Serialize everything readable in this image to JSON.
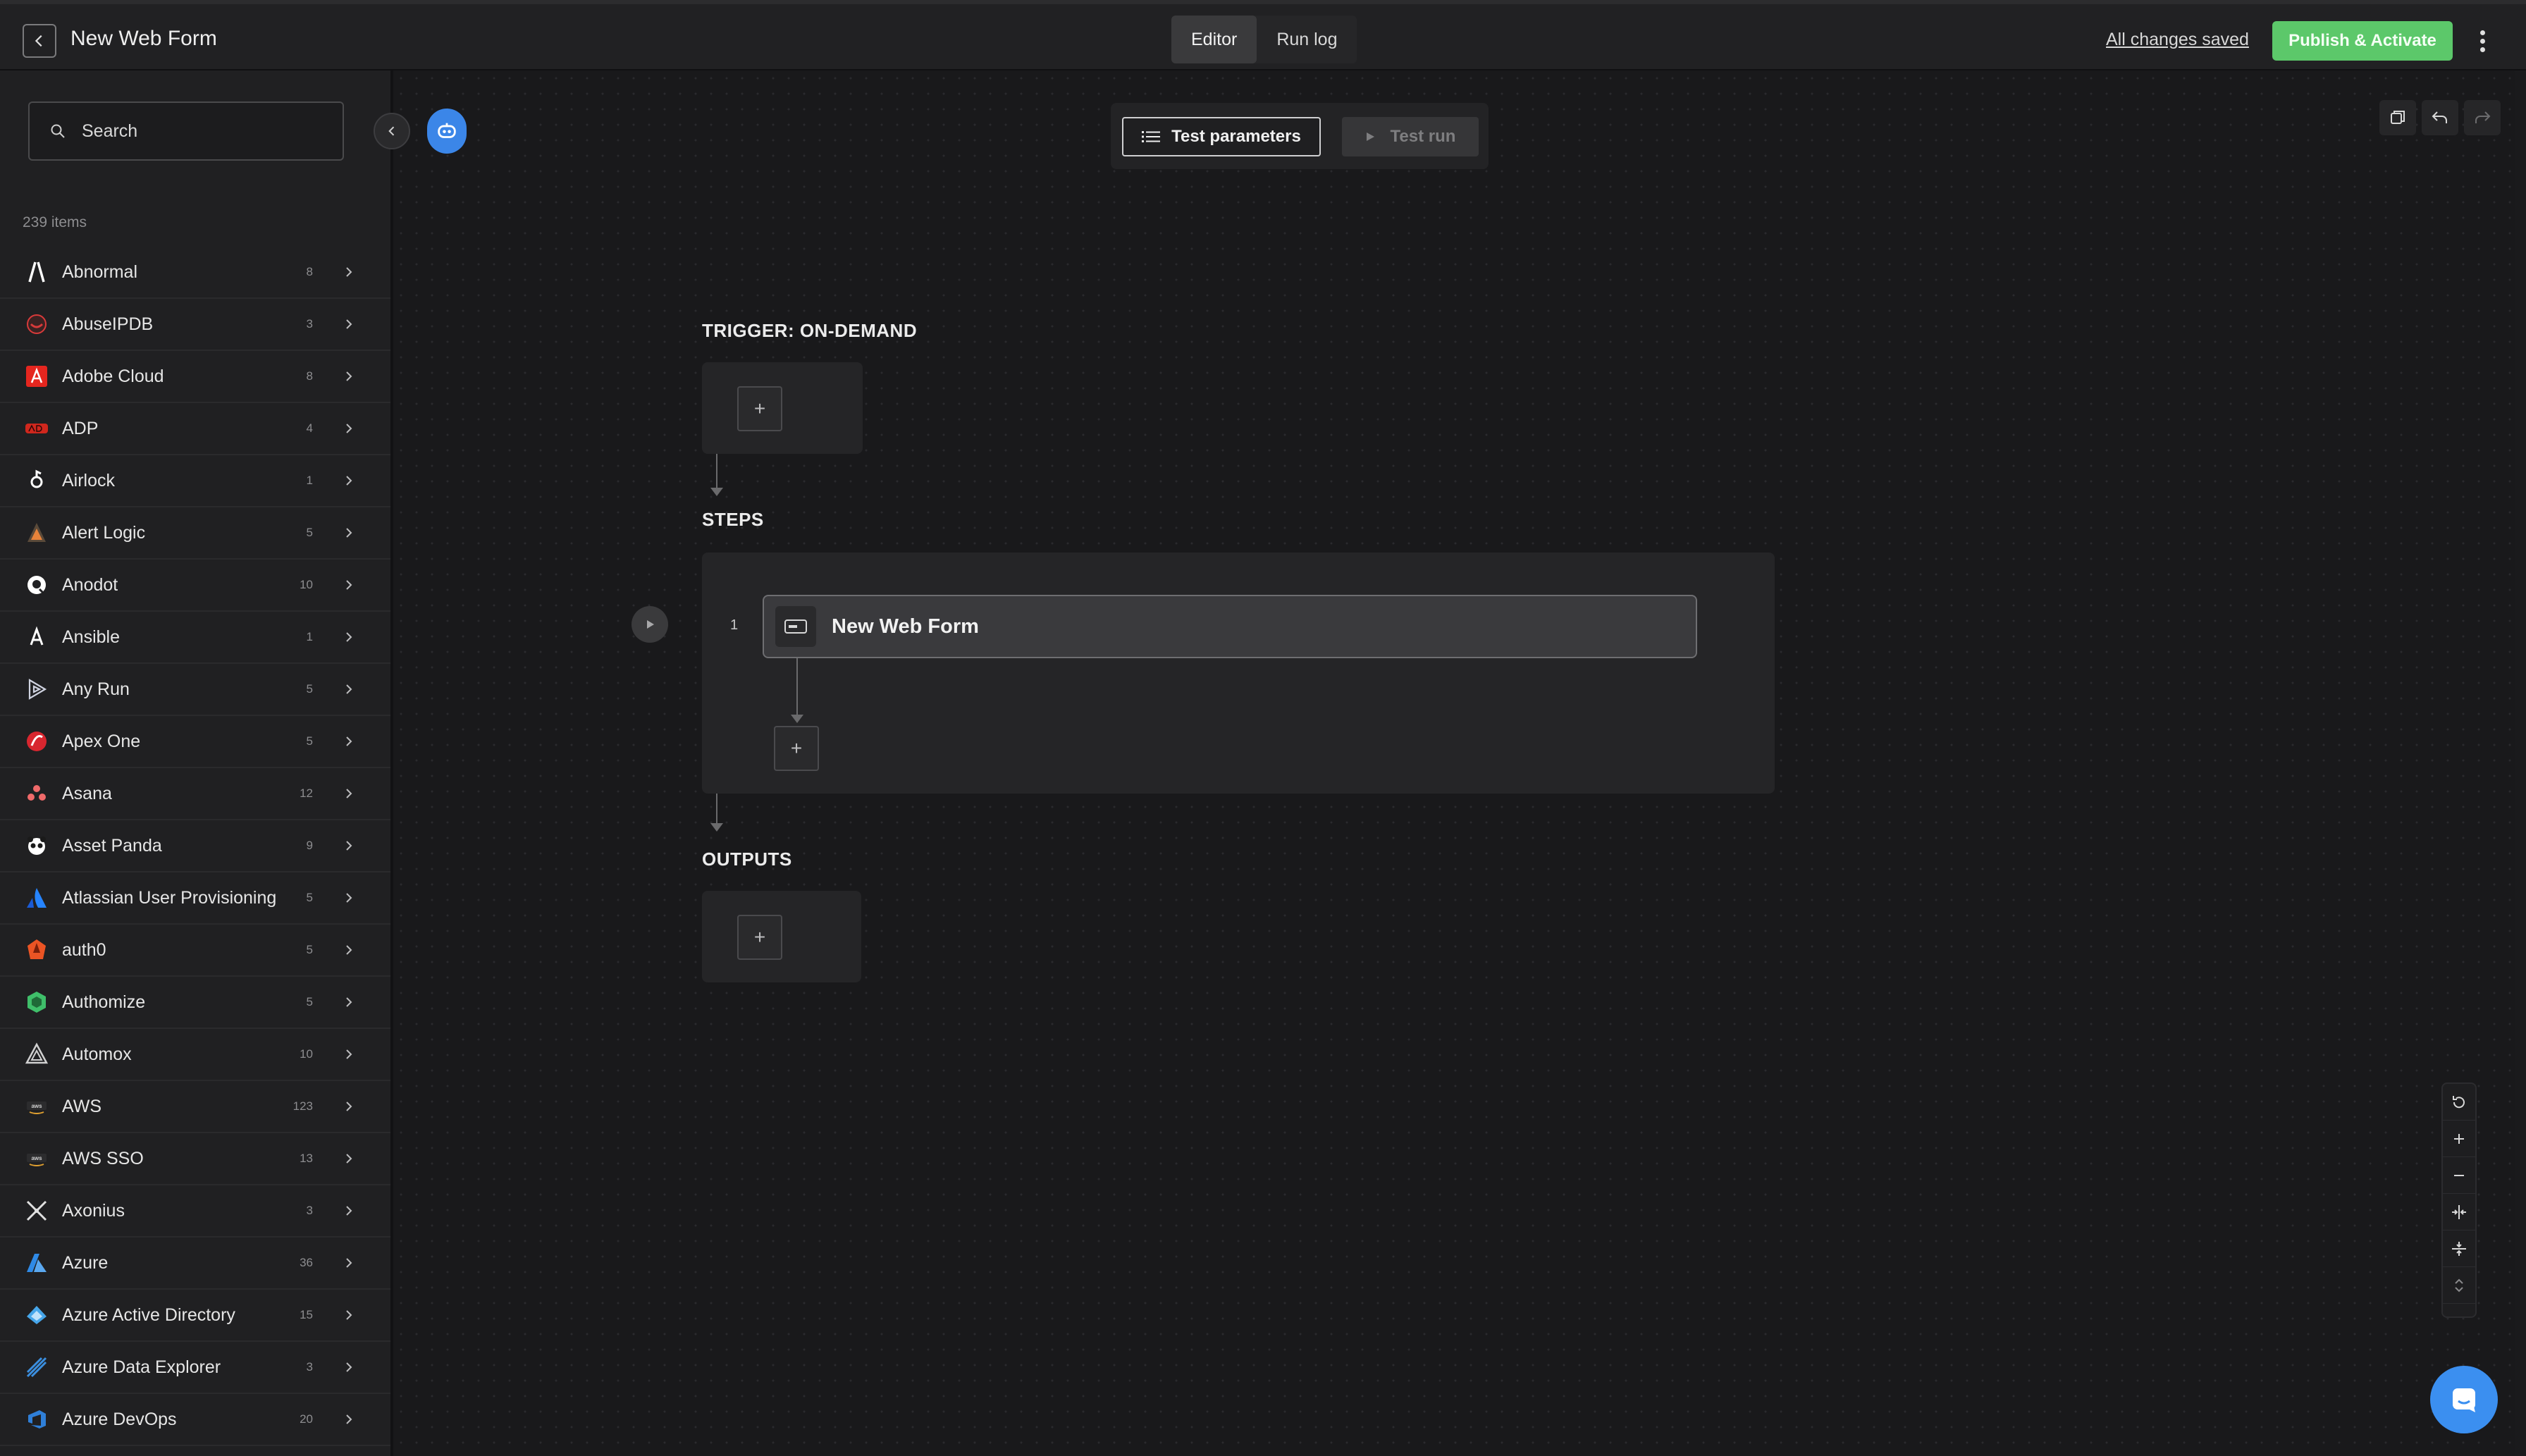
{
  "header": {
    "title": "New Web Form",
    "tabs": [
      {
        "label": "Editor",
        "active": true
      },
      {
        "label": "Run log",
        "active": false
      }
    ],
    "saved_status": "All changes saved",
    "publish_label": "Publish & Activate"
  },
  "sidebar": {
    "search_placeholder": "Search",
    "item_count": "239 items",
    "items": [
      {
        "label": "Abnormal",
        "count": "8",
        "icon": "abnormal-logo",
        "color": "#ffffff"
      },
      {
        "label": "AbuseIPDB",
        "count": "3",
        "icon": "abuseipdb-logo",
        "color": "#d83a3a"
      },
      {
        "label": "Adobe Cloud",
        "count": "8",
        "icon": "adobe-logo",
        "color": "#e5261f"
      },
      {
        "label": "ADP",
        "count": "4",
        "icon": "adp-logo",
        "color": "#d0271d"
      },
      {
        "label": "Airlock",
        "count": "1",
        "icon": "airlock-logo",
        "color": "#ffffff"
      },
      {
        "label": "Alert Logic",
        "count": "5",
        "icon": "alert-logic-logo",
        "color": "#e8833a"
      },
      {
        "label": "Anodot",
        "count": "10",
        "icon": "anodot-logo",
        "color": "#ffffff"
      },
      {
        "label": "Ansible",
        "count": "1",
        "icon": "ansible-logo",
        "color": "#ffffff"
      },
      {
        "label": "Any Run",
        "count": "5",
        "icon": "anyrun-logo",
        "color": "#cfd3e0"
      },
      {
        "label": "Apex One",
        "count": "5",
        "icon": "apex-one-logo",
        "color": "#d8262f"
      },
      {
        "label": "Asana",
        "count": "12",
        "icon": "asana-logo",
        "color": "#f06a6a"
      },
      {
        "label": "Asset Panda",
        "count": "9",
        "icon": "asset-panda-logo",
        "color": "#ffffff"
      },
      {
        "label": "Atlassian User Provisioning",
        "count": "5",
        "icon": "atlassian-logo",
        "color": "#2684ff"
      },
      {
        "label": "auth0",
        "count": "5",
        "icon": "auth0-logo",
        "color": "#eb5424"
      },
      {
        "label": "Authomize",
        "count": "5",
        "icon": "authomize-logo",
        "color": "#3fbf6a"
      },
      {
        "label": "Automox",
        "count": "10",
        "icon": "automox-logo",
        "color": "#d0d0d0"
      },
      {
        "label": "AWS",
        "count": "123",
        "icon": "aws-logo",
        "color": "#d0d0d0"
      },
      {
        "label": "AWS SSO",
        "count": "13",
        "icon": "aws-sso-logo",
        "color": "#d0d0d0"
      },
      {
        "label": "Axonius",
        "count": "3",
        "icon": "axonius-logo",
        "color": "#e0e0e0"
      },
      {
        "label": "Azure",
        "count": "36",
        "icon": "azure-logo",
        "color": "#2f8ae6"
      },
      {
        "label": "Azure Active Directory",
        "count": "15",
        "icon": "azure-ad-logo",
        "color": "#46a6ea"
      },
      {
        "label": "Azure Data Explorer",
        "count": "3",
        "icon": "azure-data-explorer-logo",
        "color": "#3b8fe0"
      },
      {
        "label": "Azure DevOps",
        "count": "20",
        "icon": "azure-devops-logo",
        "color": "#2f7fd8"
      }
    ]
  },
  "canvas": {
    "test_parameters_label": "Test parameters",
    "test_run_label": "Test run",
    "trigger_label": "TRIGGER: ON-DEMAND",
    "steps_label": "STEPS",
    "outputs_label": "OUTPUTS",
    "plus_symbol": "+",
    "step": {
      "number": "1",
      "label": "New Web Form"
    }
  },
  "colors": {
    "accent_green": "#5cc86a",
    "accent_blue": "#3b86e8",
    "background": "#19191b"
  }
}
